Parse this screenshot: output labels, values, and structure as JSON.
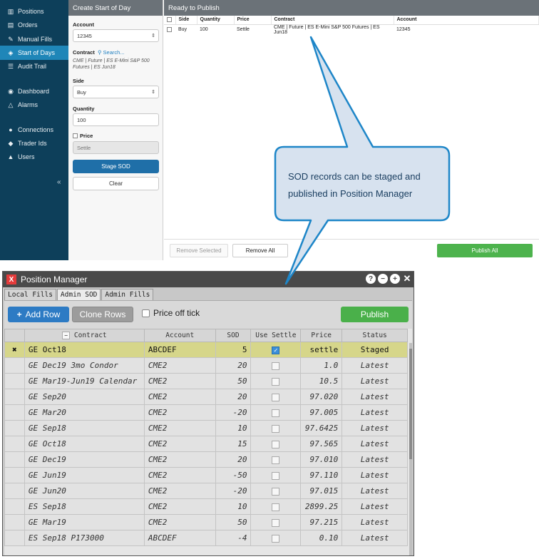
{
  "sidebar": {
    "items": [
      {
        "label": "Positions",
        "icon": "bar-chart-icon"
      },
      {
        "label": "Orders",
        "icon": "book-icon"
      },
      {
        "label": "Manual Fills",
        "icon": "wrench-icon"
      },
      {
        "label": "Start of Days",
        "icon": "tag-icon"
      },
      {
        "label": "Audit Trail",
        "icon": "list-icon"
      },
      {
        "label": "Dashboard",
        "icon": "gauge-icon"
      },
      {
        "label": "Alarms",
        "icon": "bell-icon"
      },
      {
        "label": "Connections",
        "icon": "globe-icon"
      },
      {
        "label": "Trader Ids",
        "icon": "tags-icon"
      },
      {
        "label": "Users",
        "icon": "user-icon"
      }
    ],
    "collapse_glyph": "«",
    "active_color": "#1f86b8",
    "background": "#0d3f5a"
  },
  "form": {
    "title": "Create Start of Day",
    "account_label": "Account",
    "account_value": "12345",
    "contract_label": "Contract",
    "search_label": "Search...",
    "contract_desc": "CME | Future | ES E-Mini S&P 500 Futures | ES Jun18",
    "side_label": "Side",
    "side_value": "Buy",
    "quantity_label": "Quantity",
    "quantity_value": "100",
    "price_label": "Price",
    "price_value": "Settle",
    "stage_label": "Stage SOD",
    "clear_label": "Clear"
  },
  "publish": {
    "title": "Ready to Publish",
    "columns": [
      "Side",
      "Quantity",
      "Price",
      "Contract",
      "Account"
    ],
    "rows": [
      {
        "side": "Buy",
        "quantity": "100",
        "price": "Settle",
        "contract": "CME | Future | ES E-Mini S&P 500 Futures | ES Jun18",
        "account": "12345"
      }
    ],
    "remove_selected_label": "Remove Selected",
    "remove_all_label": "Remove All",
    "publish_all_label": "Publish All"
  },
  "callout": {
    "text": "SOD records can be staged and published in Position Manager"
  },
  "pm": {
    "title": "Position Manager",
    "tabs": [
      "Local Fills",
      "Admin SOD",
      "Admin Fills"
    ],
    "active_tab": "Admin SOD",
    "add_row_label": "Add Row",
    "clone_rows_label": "Clone Rows",
    "price_off_tick_label": "Price off tick",
    "publish_label": "Publish",
    "columns": {
      "contract": "Contract",
      "account": "Account",
      "sod": "SOD",
      "use_settle": "Use Settle",
      "price": "Price",
      "status": "Status"
    },
    "rows": [
      {
        "contract": "GE Oct18",
        "account": "ABCDEF",
        "sod": "5",
        "price": "settle",
        "status": "Staged"
      },
      {
        "contract": "GE Dec19 3mo Condor",
        "account": "CME2",
        "sod": "20",
        "price": "1.0",
        "status": "Latest"
      },
      {
        "contract": "GE Mar19-Jun19 Calendar",
        "account": "CME2",
        "sod": "50",
        "price": "10.5",
        "status": "Latest"
      },
      {
        "contract": "GE Sep20",
        "account": "CME2",
        "sod": "20",
        "price": "97.020",
        "status": "Latest"
      },
      {
        "contract": "GE Mar20",
        "account": "CME2",
        "sod": "-20",
        "price": "97.005",
        "status": "Latest"
      },
      {
        "contract": "GE Sep18",
        "account": "CME2",
        "sod": "10",
        "price": "97.6425",
        "status": "Latest"
      },
      {
        "contract": "GE Oct18",
        "account": "CME2",
        "sod": "15",
        "price": "97.565",
        "status": "Latest"
      },
      {
        "contract": "GE Dec19",
        "account": "CME2",
        "sod": "20",
        "price": "97.010",
        "status": "Latest"
      },
      {
        "contract": "GE Jun19",
        "account": "CME2",
        "sod": "-50",
        "price": "97.110",
        "status": "Latest"
      },
      {
        "contract": "GE Jun20",
        "account": "CME2",
        "sod": "-20",
        "price": "97.015",
        "status": "Latest"
      },
      {
        "contract": "ES Sep18",
        "account": "CME2",
        "sod": "10",
        "price": "2899.25",
        "status": "Latest"
      },
      {
        "contract": "GE Mar19",
        "account": "CME2",
        "sod": "50",
        "price": "97.215",
        "status": "Latest"
      },
      {
        "contract": "ES Sep18 P173000",
        "account": "ABCDEF",
        "sod": "-4",
        "price": "0.10",
        "status": "Latest"
      }
    ],
    "staged_color": "#d6d68a",
    "publish_color": "#4ab04a",
    "add_row_color": "#2d7bc4"
  }
}
